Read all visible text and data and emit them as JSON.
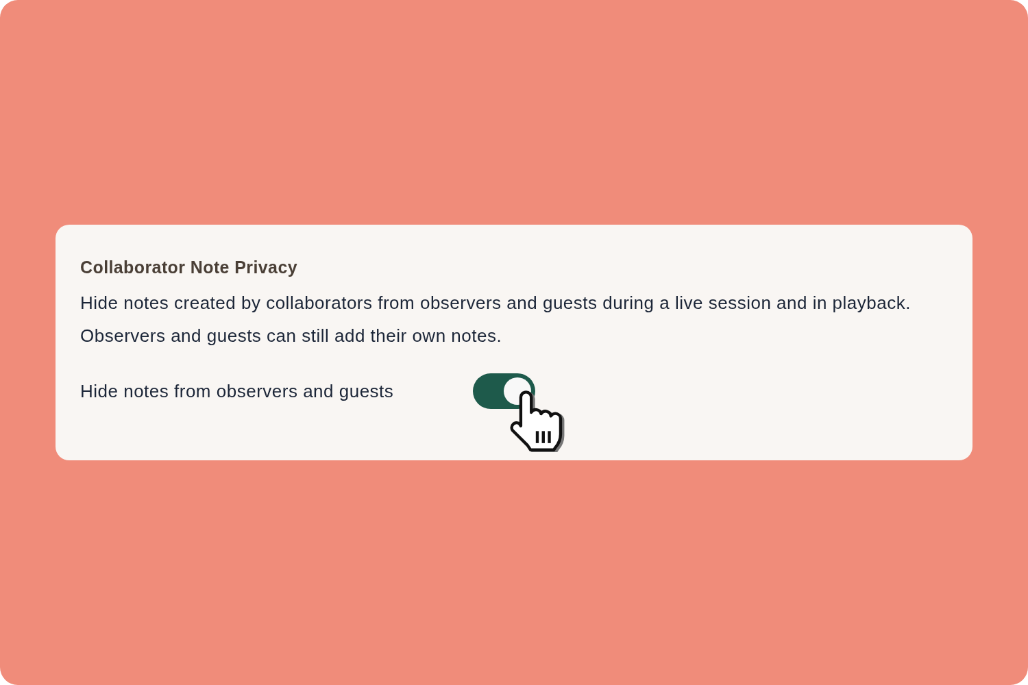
{
  "setting": {
    "title": "Collaborator Note Privacy",
    "description": [
      "Hide notes created by collaborators from observers and guests during a live session and in playback.",
      "Observers and guests can still add their own notes."
    ],
    "toggle": {
      "label": "Hide notes from observers and guests",
      "on": true
    }
  }
}
